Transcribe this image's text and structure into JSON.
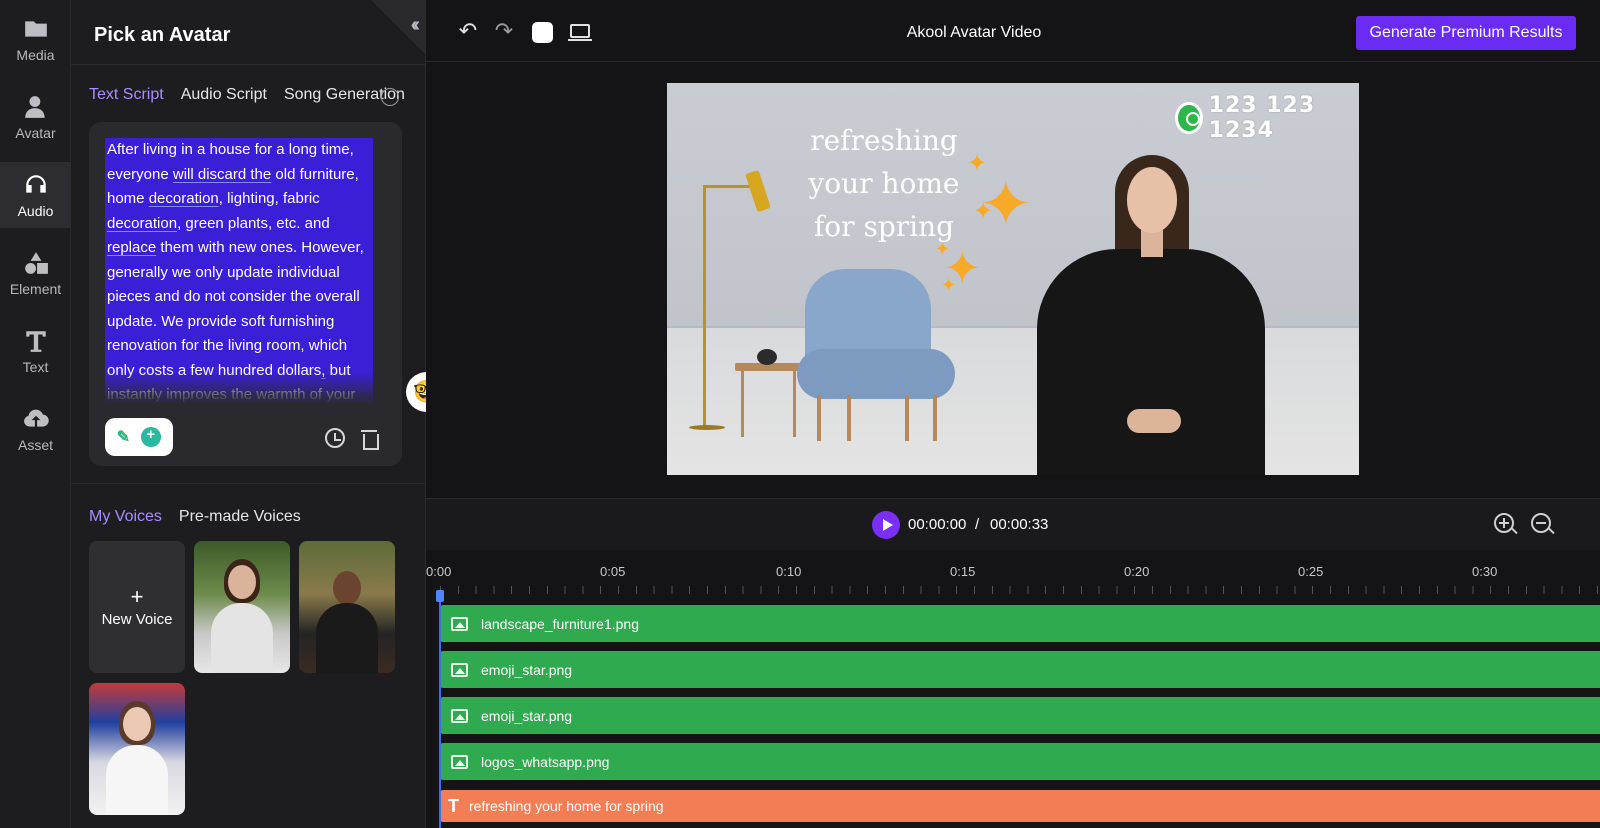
{
  "rail": {
    "items": [
      {
        "label": "Media",
        "icon": "folder-icon"
      },
      {
        "label": "Avatar",
        "icon": "avatar-icon"
      },
      {
        "label": "Audio",
        "icon": "headphones-icon",
        "active": true
      },
      {
        "label": "Element",
        "icon": "shapes-icon"
      },
      {
        "label": "Text",
        "icon": "text-icon"
      },
      {
        "label": "Asset",
        "icon": "cloud-upload-icon"
      }
    ]
  },
  "panel": {
    "title": "Pick an Avatar",
    "tabs": [
      "Text Script",
      "Audio Script",
      "Song Generation"
    ],
    "script_text_parts": [
      "After living in a house for a long time, everyone ",
      "will discard the",
      " old furniture, home ",
      "decoration",
      ", lighting, fabric ",
      "decoration",
      ", green plants, etc. and ",
      "replace",
      " them with new ones. However, generally we only update individual pieces and do not consider the overall update. We provide soft furnishing renovation for the living room, which only costs a few hundred dollars",
      ",",
      " but instantly improves the warmth of your home by several levels! Contact us"
    ],
    "voice_tabs": [
      "My Voices",
      "Pre-made Voices"
    ],
    "new_voice_label": "New Voice",
    "new_voice_plus": "+"
  },
  "topbar": {
    "undo_glyph": "↶",
    "redo_glyph": "↷",
    "project_title": "Akool Avatar Video",
    "generate_label": "Generate Premium Results"
  },
  "canvas": {
    "phone_number": "123 123 1234",
    "overlay_text_lines": [
      "refreshing",
      "your home",
      "for spring"
    ],
    "star_glyph": "✦"
  },
  "playback": {
    "current_time": "00:00:00",
    "separator": "/",
    "total_time": "00:00:33"
  },
  "timeline": {
    "ticks": [
      "0:00",
      "0:05",
      "0:10",
      "0:15",
      "0:20",
      "0:25",
      "0:30"
    ],
    "tracks": [
      {
        "label": "landscape_furniture1.png",
        "kind": "image"
      },
      {
        "label": "emoji_star.png",
        "kind": "image"
      },
      {
        "label": "emoji_star.png",
        "kind": "image"
      },
      {
        "label": "logos_whatsapp.png",
        "kind": "image"
      },
      {
        "label": "refreshing your home for spring",
        "kind": "text"
      }
    ]
  },
  "colors": {
    "accent": "#6a2bf5",
    "tab_active": "#a98cff",
    "image_track": "#2faa4f",
    "text_track": "#f37e55",
    "highlight": "#3a1fd6"
  }
}
